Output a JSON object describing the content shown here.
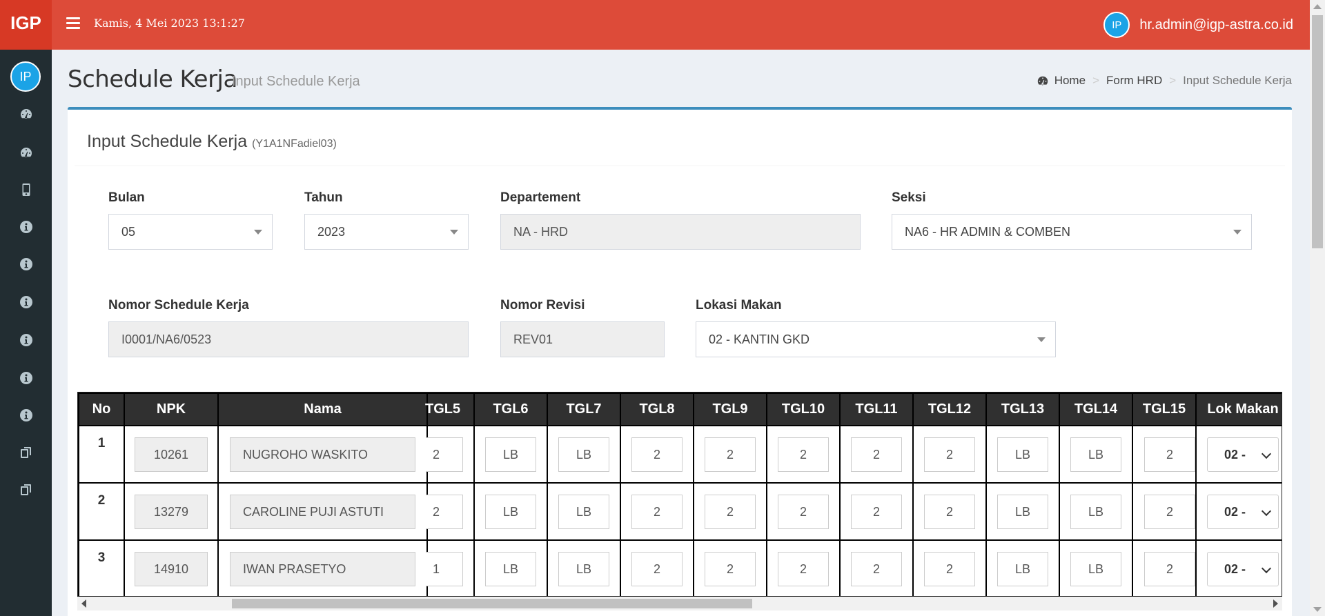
{
  "app": {
    "logo": "IGP",
    "datetime": "Kamis, 4 Mei 2023 13:1:27"
  },
  "user": {
    "avatar_initials": "IP",
    "email": "hr.admin@igp-astra.co.id"
  },
  "sidebar": {
    "avatar_initials": "IP",
    "items": [
      {
        "icon": "dashboard-icon"
      },
      {
        "icon": "dashboard-icon"
      },
      {
        "icon": "mobile-icon"
      },
      {
        "icon": "info-circle-icon"
      },
      {
        "icon": "info-circle-icon"
      },
      {
        "icon": "info-circle-icon"
      },
      {
        "icon": "info-circle-icon"
      },
      {
        "icon": "info-circle-icon"
      },
      {
        "icon": "info-circle-icon"
      },
      {
        "icon": "copy-icon"
      },
      {
        "icon": "copy-icon"
      }
    ]
  },
  "header": {
    "title": "Schedule Kerja",
    "subtitle": "Input Schedule Kerja",
    "breadcrumb": [
      "Home",
      "Form HRD",
      "Input Schedule Kerja"
    ]
  },
  "box": {
    "title": "Input Schedule Kerja",
    "title_small": "(Y1A1NFadiel03)"
  },
  "form": {
    "bulan": {
      "label": "Bulan",
      "value": "05"
    },
    "tahun": {
      "label": "Tahun",
      "value": "2023"
    },
    "departement": {
      "label": "Departement",
      "value": "NA - HRD"
    },
    "seksi": {
      "label": "Seksi",
      "value": "NA6 - HR ADMIN & COMBEN"
    },
    "nomor_schedule": {
      "label": "Nomor Schedule Kerja",
      "value": "I0001/NA6/0523"
    },
    "nomor_revisi": {
      "label": "Nomor Revisi",
      "value": "REV01"
    },
    "lokasi_makan": {
      "label": "Lokasi Makan",
      "value": "02 - KANTIN GKD"
    }
  },
  "table": {
    "headers": [
      "No",
      "NPK",
      "Nama",
      "TGL5",
      "TGL6",
      "TGL7",
      "TGL8",
      "TGL9",
      "TGL10",
      "TGL11",
      "TGL12",
      "TGL13",
      "TGL14",
      "TGL15",
      "Lok Makan"
    ],
    "rows": [
      {
        "no": "1",
        "npk": "10261",
        "nama": "NUGROHO WASKITO",
        "tgl": [
          "2",
          "LB",
          "LB",
          "2",
          "2",
          "2",
          "2",
          "2",
          "LB",
          "LB",
          "2"
        ],
        "lok": "02 -"
      },
      {
        "no": "2",
        "npk": "13279",
        "nama": "CAROLINE PUJI ASTUTI",
        "tgl": [
          "2",
          "LB",
          "LB",
          "2",
          "2",
          "2",
          "2",
          "2",
          "LB",
          "LB",
          "2"
        ],
        "lok": "02 -"
      },
      {
        "no": "3",
        "npk": "14910",
        "nama": "IWAN PRASETYO",
        "tgl": [
          "1",
          "LB",
          "LB",
          "2",
          "2",
          "2",
          "2",
          "2",
          "LB",
          "LB",
          "2"
        ],
        "lok": "02 -"
      }
    ]
  },
  "colors": {
    "header_red": "#dd4b39",
    "logo_red": "#d73925",
    "sidebar": "#222d32",
    "box_accent": "#3c8dbc",
    "avatar_blue": "#1ba3e6"
  }
}
